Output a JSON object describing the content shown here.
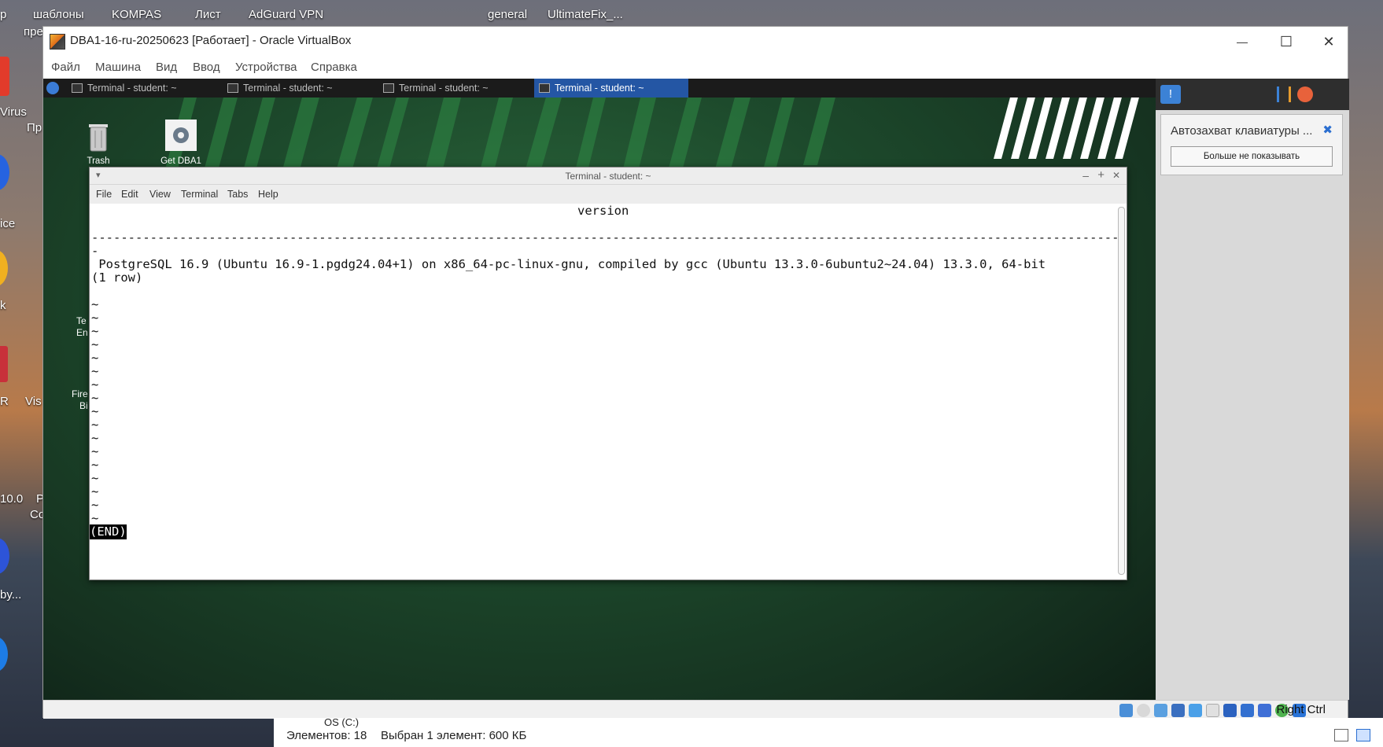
{
  "host": {
    "desktop_icons": [
      "шаблоны",
      "KOMPAS",
      "Лист",
      "AdGuard VPN",
      "general",
      "UltimateFix_..."
    ],
    "left_fragments": [
      "р",
      "пре",
      "Virus",
      "Пр",
      "ice",
      "k",
      "R",
      "Vis",
      "10.0",
      "P",
      "Co",
      "by..."
    ]
  },
  "vbox": {
    "title": "DBA1-16-ru-20250623 [Работает] - Oracle VirtualBox",
    "menu": [
      "Файл",
      "Машина",
      "Вид",
      "Ввод",
      "Устройства",
      "Справка"
    ],
    "window_buttons": {
      "minimize": "—",
      "maximize": "☐",
      "close": "✕"
    },
    "host_key": "Right Ctrl"
  },
  "guest": {
    "tasks": [
      "Terminal - student: ~",
      "Terminal - student: ~",
      "Terminal - student: ~",
      "Terminal - student: ~"
    ],
    "active_task": 3,
    "desktop_icons": [
      "Trash",
      "Get DBA1"
    ],
    "desktop_fragments": [
      "Te",
      "En",
      "Fire",
      "Bi"
    ]
  },
  "terminal": {
    "title": "Terminal - student: ~",
    "menu": [
      "File",
      "Edit",
      "View",
      "Terminal",
      "Tabs",
      "Help"
    ],
    "window_buttons": {
      "minimize": "–",
      "maximize": "+",
      "close": "✕"
    },
    "header": "version",
    "separator": "----------------------------------------------------------------------------------------------------------------------------------------------",
    "separator_wrap": "-",
    "result_line": " PostgreSQL 16.9 (Ubuntu 16.9-1.pgdg24.04+1) on x86_64-pc-linux-gnu, compiled by gcc (Ubuntu 13.3.0-6ubuntu2~24.04) 13.3.0, 64-bit",
    "row_count": "(1 row)",
    "tilde_lines": [
      "",
      "~",
      "~",
      "~",
      "~",
      "~",
      "~",
      "~",
      "~",
      "~",
      "~",
      "~",
      "~",
      "~",
      "~",
      "~",
      "~",
      "~"
    ],
    "end_marker": "(END)"
  },
  "side_panel": {
    "popup_title": "Автозахват клавиатуры ...",
    "popup_button": "Больше не показывать"
  },
  "explorer": {
    "drive": "OS (C:)",
    "items_count": "Элементов: 18",
    "selection": "Выбран 1 элемент: 600 КБ"
  }
}
